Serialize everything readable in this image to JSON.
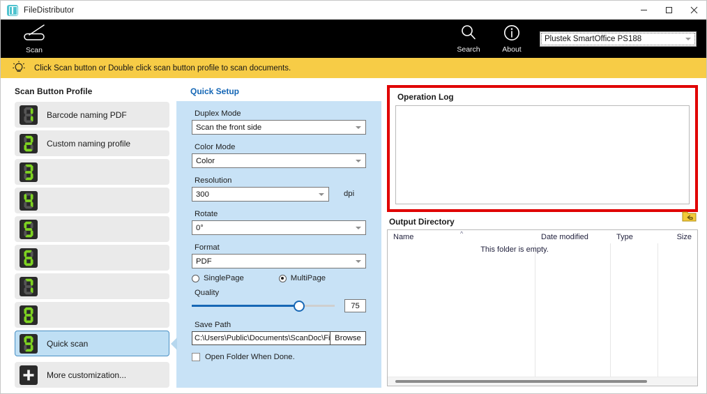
{
  "window": {
    "title": "FileDistributor",
    "icon": "app-book-icon",
    "controls": {
      "minimize": "minimize-icon",
      "maximize": "maximize-icon",
      "close": "close-icon"
    }
  },
  "toolbar": {
    "background": "#000000",
    "scan": {
      "label": "Scan",
      "icon": "scanner-icon"
    },
    "search": {
      "label": "Search",
      "icon": "search-icon"
    },
    "about": {
      "label": "About",
      "icon": "info-icon"
    },
    "device": {
      "value": "Plustek SmartOffice PS188",
      "caret": "chevron-down-icon"
    }
  },
  "notice": {
    "icon": "lightbulb-icon",
    "background": "#f7cc46",
    "text": "Click Scan button or Double click scan button profile to scan documents."
  },
  "profiles": {
    "title": "Scan Button Profile",
    "items": [
      {
        "digit": "1",
        "label": "Barcode naming PDF",
        "selected": false
      },
      {
        "digit": "2",
        "label": "Custom naming profile",
        "selected": false
      },
      {
        "digit": "3",
        "label": "",
        "selected": false
      },
      {
        "digit": "4",
        "label": "",
        "selected": false
      },
      {
        "digit": "5",
        "label": "",
        "selected": false
      },
      {
        "digit": "6",
        "label": "",
        "selected": false
      },
      {
        "digit": "7",
        "label": "",
        "selected": false
      },
      {
        "digit": "8",
        "label": "",
        "selected": false
      },
      {
        "digit": "9",
        "label": "Quick scan",
        "selected": true
      }
    ],
    "more": {
      "label": "More customization...",
      "icon": "plus-icon"
    },
    "selected_accent": "#4a90c4"
  },
  "quick_setup": {
    "title": "Quick Setup",
    "title_color": "#1466b5",
    "panel_background": "#c8e2f6",
    "duplex": {
      "label": "Duplex Mode",
      "value": "Scan the front side"
    },
    "color_mode": {
      "label": "Color Mode",
      "value": "Color"
    },
    "resolution": {
      "label": "Resolution",
      "value": "300",
      "unit": "dpi"
    },
    "rotate": {
      "label": "Rotate",
      "value": "0°"
    },
    "format": {
      "label": "Format",
      "value": "PDF"
    },
    "page_mode": {
      "single": "SinglePage",
      "multi": "MultiPage",
      "selected": "MultiPage"
    },
    "quality": {
      "label": "Quality",
      "value": "75",
      "percent": 75
    },
    "save_path": {
      "label": "Save Path",
      "value": "C:\\Users\\Public\\Documents\\ScanDoc\\FileDistribut",
      "browse": "Browse"
    },
    "open_folder": {
      "label": "Open Folder When Done.",
      "checked": false
    }
  },
  "operation_log": {
    "title": "Operation Log",
    "highlight_color": "#e00000",
    "entries": []
  },
  "output_directory": {
    "title": "Output Directory",
    "back_button": "folder-back-icon",
    "columns": [
      "Name",
      "Date modified",
      "Type",
      "Size"
    ],
    "sort_indicator": "chevron-up-icon",
    "empty_message": "This folder is empty.",
    "rows": []
  }
}
